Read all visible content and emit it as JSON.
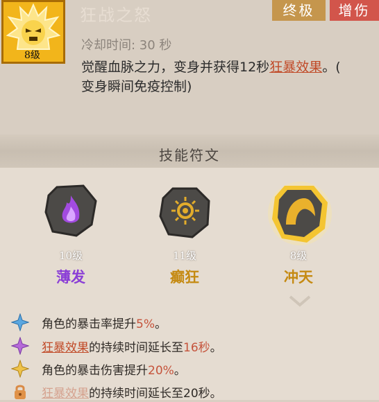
{
  "skill": {
    "name": "狂战之怒",
    "level_badge": "8级",
    "tags": [
      "终极",
      "增伤"
    ],
    "cooldown": "冷却时间: 30 秒",
    "desc_line1_a": "觉醒血脉之力，变身并获得12秒",
    "desc_line1_kw": "狂暴效果",
    "desc_line1_b": "。(",
    "desc_line2": "变身瞬间免疫控制)"
  },
  "runes_section": {
    "title": "技能符文",
    "runes": [
      {
        "level": "10级",
        "name": "薄发",
        "name_color": "#8b3fd6",
        "icon": "purple-flame-icon"
      },
      {
        "level": "11级",
        "name": "癫狂",
        "name_color": "#c58a12",
        "icon": "gold-eye-icon"
      },
      {
        "level": "8级",
        "name": "冲天",
        "name_color": "#c58a12",
        "icon": "gold-wave-icon"
      }
    ]
  },
  "bonuses": [
    {
      "icon": "blue-star-icon",
      "pre": "角色的暴击率提升",
      "value": "5%",
      "post": "。",
      "locked": false
    },
    {
      "icon": "purple-star-icon",
      "kw": "狂暴效果",
      "pre": "的持续时间延长至",
      "value": "16秒",
      "post": "。",
      "locked": false
    },
    {
      "icon": "gold-star-icon",
      "pre": "角色的暴击伤害提升",
      "value": "20%",
      "post": "。",
      "locked": false
    },
    {
      "icon": "lock-icon",
      "kw": "狂暴效果",
      "pre": "的持续时间延长至",
      "value": "20秒",
      "post": "。",
      "locked": true
    }
  ],
  "colors": {
    "tag_final": "#c5964d",
    "tag_damage": "#d2554b",
    "keyword": "#c14b29",
    "highlight": "#c5533b"
  }
}
